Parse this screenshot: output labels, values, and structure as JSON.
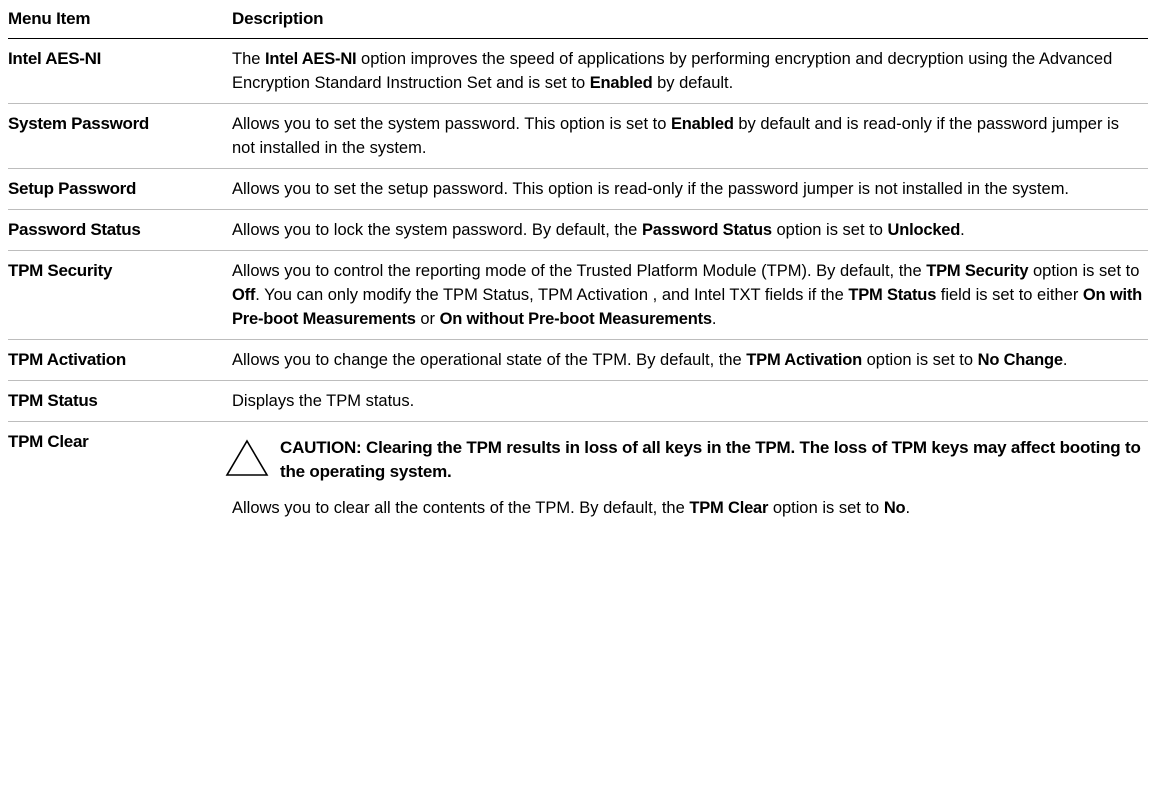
{
  "table": {
    "header": {
      "menu_item": "Menu Item",
      "description": "Description"
    },
    "rows": [
      {
        "item": "Intel AES-NI",
        "desc": [
          {
            "t": "The "
          },
          {
            "b": "Intel AES-NI"
          },
          {
            "t": " option improves the speed of applications by performing encryption and decryption using the Advanced Encryption Standard Instruction Set and is set to "
          },
          {
            "b": "Enabled"
          },
          {
            "t": " by default."
          }
        ]
      },
      {
        "item": "System Password",
        "desc": [
          {
            "t": "Allows you to set the system password. This option is set to "
          },
          {
            "b": "Enabled"
          },
          {
            "t": " by default and is read-only if the password jumper is not installed in the system."
          }
        ]
      },
      {
        "item": "Setup Password",
        "desc": [
          {
            "t": "Allows you to set the setup password. This option is read-only if the password jumper is not installed in the system."
          }
        ]
      },
      {
        "item": "Password Status",
        "desc": [
          {
            "t": "Allows you to lock the system password. By default, the "
          },
          {
            "b": "Password Status"
          },
          {
            "t": " option is set to "
          },
          {
            "b": "Unlocked"
          },
          {
            "t": "."
          }
        ]
      },
      {
        "item": "TPM Security",
        "desc": [
          {
            "t": "Allows you to control the reporting mode of the Trusted Platform Module (TPM). By default, the "
          },
          {
            "b": "TPM Security"
          },
          {
            "t": " option is set to "
          },
          {
            "b": "Off"
          },
          {
            "t": ". You can only modify the TPM Status, TPM Activation , and Intel TXT fields if the "
          },
          {
            "b": "TPM Status"
          },
          {
            "t": " field is set to either "
          },
          {
            "b": "On with Pre-boot Measurements"
          },
          {
            "t": " or "
          },
          {
            "b": "On without Pre-boot Measurements"
          },
          {
            "t": "."
          }
        ]
      },
      {
        "item": "TPM Activation",
        "desc": [
          {
            "t": "Allows you to change the operational state of the TPM. By default, the "
          },
          {
            "b": "TPM Activation"
          },
          {
            "t": " option is set to "
          },
          {
            "b": "No Change"
          },
          {
            "t": "."
          }
        ]
      },
      {
        "item": "TPM Status",
        "desc": [
          {
            "t": "Displays the TPM status."
          }
        ]
      },
      {
        "item": "TPM Clear",
        "caution_icon": "warning-triangle-icon",
        "caution": "CAUTION: Clearing the TPM results in loss of all keys in the TPM. The loss of TPM keys may affect booting to the operating system.",
        "desc": [
          {
            "t": "Allows you to clear all the contents of the TPM. By default, the "
          },
          {
            "b": "TPM Clear"
          },
          {
            "t": " option is set to "
          },
          {
            "b": "No"
          },
          {
            "t": "."
          }
        ]
      }
    ]
  }
}
